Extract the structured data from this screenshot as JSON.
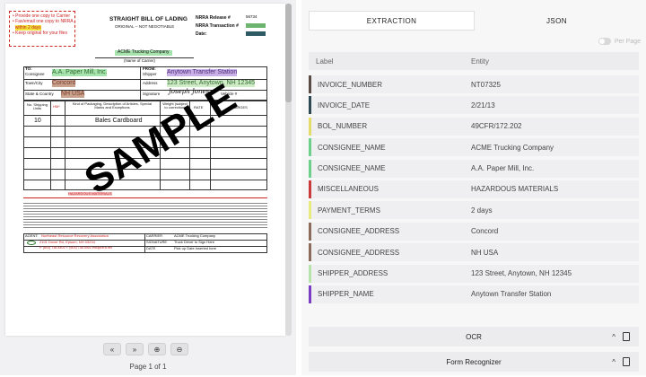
{
  "document": {
    "notes": [
      "Provide one copy to Carrier",
      "Fax/email one copy to NRRA",
      "within 2 days",
      "Keep original for your files"
    ],
    "title": "STRAIGHT BILL OF LADING",
    "subtitle": "ORIGINAL -- NOT NEGOTIABLE",
    "release_label": "NRRA Release #",
    "release_value": "56734",
    "transaction_label": "NRRA Transaction #",
    "date_label": "Date:",
    "carrier_name": "ACME Trucking Company",
    "name_of_carrier": "(Name of Carrier)",
    "to_label": "TO:",
    "consignee_label": "Consignee",
    "consignee_value": "A.A. Paper Mill, Inc.",
    "from_label": "FROM:",
    "shipper_label": "Shipper",
    "shipper_value": "Anytown Transfer Station",
    "town_label": "Town/City",
    "town_value": "Concord",
    "address_label": "Address",
    "address_value": "123 Street, Anytown, NH 12345",
    "state_label": "State & Country",
    "state_value": "NH USA",
    "signature_label": "Signature",
    "signature_value": "Joseph Jones",
    "vehicle_label": "Vehicle #",
    "col_units": "No. Shipping Units",
    "col_hm": "HM*",
    "col_kind": "Kind of Packaging, Description of Articles, Special Marks and Exceptions",
    "col_weight": "Weight (subject to correction)",
    "col_rate": "RATE",
    "col_charges": "CHARGES",
    "item_units": "10",
    "item_desc": "Bales Cardboard",
    "hazmat_line": "HAZARDOUS MATERIALS",
    "watermark": "SAMPLE",
    "agent_label": "AGENT:",
    "agent_value": "Northeast Resource Recovery Association",
    "carrier_label": "CARRIER",
    "carrier_value": "ACME Trucking Company",
    "agent_address": "2101 Dover Rd, Epsom, NH 03234",
    "agent_phone": "P. (603) 736-4401 F. (603) 736-4402 info@nrra.net",
    "sig_label": "SIGNATURE",
    "sig_value": "Truck Driver to Sign Here",
    "date2_label": "DATE",
    "date2_value": "Pick up Date inserted here"
  },
  "viewer": {
    "buttons": [
      "«",
      "»",
      "⊕",
      "⊖"
    ],
    "page_info": "Page 1 of 1"
  },
  "tabs": {
    "extraction": "EXTRACTION",
    "json": "JSON"
  },
  "per_page_label": "Per Page",
  "table": {
    "col_label": "Label",
    "col_entity": "Entity"
  },
  "rows": [
    {
      "label": "INVOICE_NUMBER",
      "entity": "NT07325",
      "color": "#5a4a44"
    },
    {
      "label": "INVOICE_DATE",
      "entity": "2/21/13",
      "color": "#2d4a54"
    },
    {
      "label": "BOL_NUMBER",
      "entity": "49CFR/172.202",
      "color": "#e4dc6a"
    },
    {
      "label": "CONSIGNEE_NAME",
      "entity": "ACME Trucking Company",
      "color": "#6cd08a"
    },
    {
      "label": "CONSIGNEE_NAME",
      "entity": "A.A. Paper Mill, Inc.",
      "color": "#6cd08a"
    },
    {
      "label": "MISCELLANEOUS",
      "entity": "HAZARDOUS MATERIALS",
      "color": "#c93a3a"
    },
    {
      "label": "PAYMENT_TERMS",
      "entity": "2 days",
      "color": "#e8ea80"
    },
    {
      "label": "CONSIGNEE_ADDRESS",
      "entity": "Concord",
      "color": "#8a6a58"
    },
    {
      "label": "CONSIGNEE_ADDRESS",
      "entity": "NH USA",
      "color": "#8a6a58"
    },
    {
      "label": "SHIPPER_ADDRESS",
      "entity": "123 Street, Anytown, NH 12345",
      "color": "#b9e3ad"
    },
    {
      "label": "SHIPPER_NAME",
      "entity": "Anytown Transfer Station",
      "color": "#7a3ec2"
    }
  ],
  "sections": [
    {
      "title": "OCR",
      "icon1": "^",
      "icon2": "download-icon"
    },
    {
      "title": "Form Recognizer",
      "icon1": "^",
      "icon2": "download-icon"
    }
  ]
}
